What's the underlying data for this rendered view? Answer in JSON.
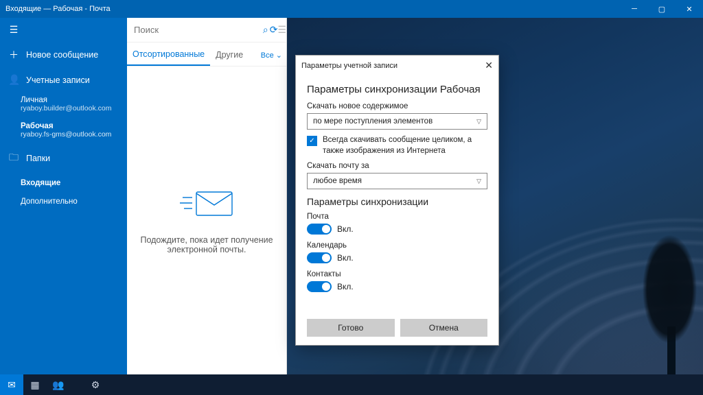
{
  "titlebar": {
    "title": "Входящие — Рабочая - Почта"
  },
  "sidebar": {
    "new_msg": "Новое сообщение",
    "accounts": "Учетные записи",
    "acct1": {
      "name": "Личная",
      "email": "ryaboy.builder@outlook.com"
    },
    "acct2": {
      "name": "Рабочая",
      "email": "ryaboy.fs-gms@outlook.com"
    },
    "folders": "Папки",
    "inbox": "Входящие",
    "more": "Дополнительно"
  },
  "search": {
    "placeholder": "Поиск"
  },
  "tabs": {
    "sorted": "Отсортированные",
    "other": "Другие",
    "all": "Все"
  },
  "empty": {
    "l1": "Подождите, пока идет получение",
    "l2": "электронной почты."
  },
  "dialog": {
    "title": "Параметры учетной записи",
    "heading": "Параметры синхронизации Рабочая",
    "dl_new": "Скачать новое содержимое",
    "sel1": "по мере поступления элементов",
    "chk": "Всегда скачивать сообщение целиком, а также изображения из Интернета",
    "dl_for": "Скачать почту за",
    "sel2": "любое время",
    "sync_head": "Параметры синхронизации",
    "mail": "Почта",
    "cal": "Календарь",
    "cont": "Контакты",
    "on": "Вкл.",
    "done": "Готово",
    "cancel": "Отмена"
  }
}
